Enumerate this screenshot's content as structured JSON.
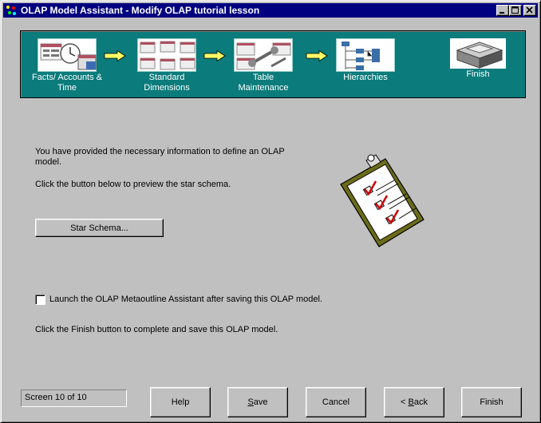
{
  "window": {
    "title": "OLAP Model Assistant - Modify OLAP tutorial lesson"
  },
  "steps": [
    {
      "label_line1": "Facts/ Accounts &",
      "label_line2": "Time"
    },
    {
      "label_line1": "Standard",
      "label_line2": "Dimensions"
    },
    {
      "label_line1": "Table",
      "label_line2": "Maintenance"
    },
    {
      "label_line1": "Hierarchies",
      "label_line2": ""
    },
    {
      "label_line1": "Finish",
      "label_line2": ""
    }
  ],
  "content": {
    "info_line1": "You have provided the necessary information to define an OLAP",
    "info_line2": "model.",
    "preview_text": "Click the button below to preview the star schema.",
    "star_schema_button": "Star Schema...",
    "launch_checkbox_label": "Launch the OLAP Metaoutline Assistant after saving this OLAP model.",
    "launch_checked": false,
    "finish_text": "Click the Finish button to complete and save this OLAP model."
  },
  "footer": {
    "status": "Screen 10 of 10",
    "help": "Help",
    "save_u": "S",
    "save_rest": "ave",
    "cancel": "Cancel",
    "back_prefix": "< ",
    "back_u": "B",
    "back_rest": "ack",
    "finish": "Finish"
  },
  "colors": {
    "title_bar": "#000080",
    "banner": "#0b7b7b",
    "arrow": "#ffff66",
    "clipboard_board": "#6b6b1a",
    "check": "#cc0000"
  }
}
